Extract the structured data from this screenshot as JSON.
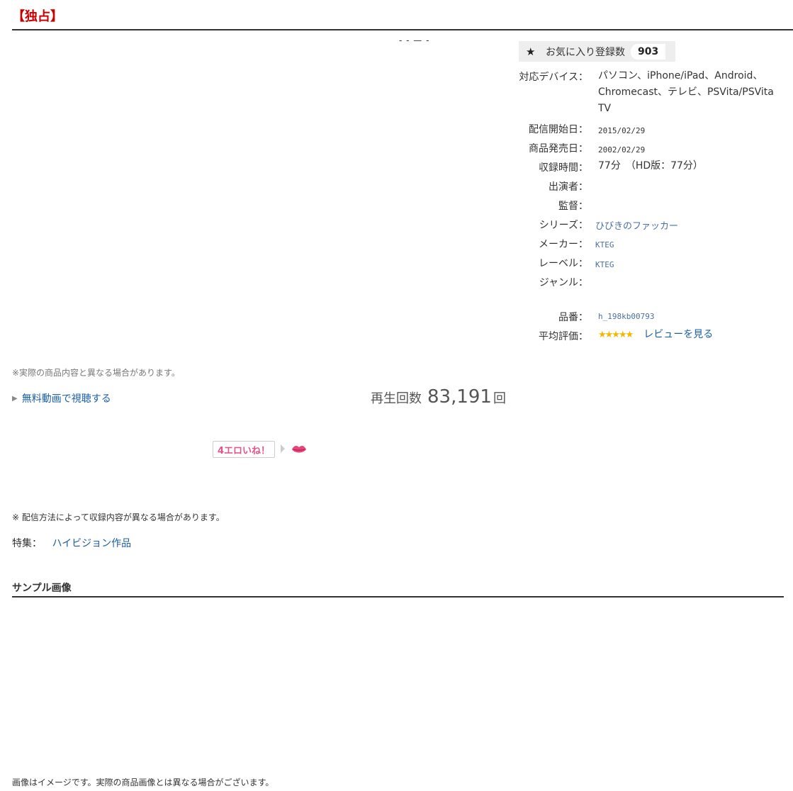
{
  "title": "【独占】",
  "player_placeholder": "- - — -",
  "favorite": {
    "label": "お気に入り登録数",
    "count": "903"
  },
  "spec": {
    "devices_label": "対応デバイス：",
    "devices_value": "パソコン、iPhone/iPad、Android、Chromecast、テレビ、PSVita/PSVita TV",
    "delivery_start_label": "配信開始日：",
    "delivery_start_value": "2015/02/29",
    "release_label": "商品発売日：",
    "release_value": "2002/02/29",
    "duration_label": "収録時間：",
    "duration_value": "77分　（HD版：77分）",
    "cast_label": "出演者：",
    "director_label": "監督：",
    "series_label": "シリーズ：",
    "series_value": "ひびきのファッカー",
    "maker_label": "メーカー：",
    "maker_value": "KTEG",
    "label_label": "レーベル：",
    "label_value": "KTEG",
    "genre_label": "ジャンル：",
    "product_code_label": "品番：",
    "product_code_value": "h_198kb00793",
    "rating_label": "平均評価：",
    "rating_stars": "★★★★★",
    "review_link": "レビューを見る"
  },
  "notice_content": "※実際の商品内容と異なる場合があります。",
  "free_video_link": "無料動画で視聴する",
  "play_count": {
    "prefix": "再生回数",
    "value": "83,191",
    "suffix": "回"
  },
  "like_button": "4エロいね！",
  "notice_method": "※ 配信方法によって収録内容が異なる場合があります。",
  "special": {
    "label": "特集：",
    "link": "ハイビジョン作品"
  },
  "sample_section_title": "サンプル画像",
  "notice_image": "画像はイメージです。実際の商品画像とは異なる場合がございます。",
  "colors": {
    "title": "#cc0000",
    "link": "#1a5fa6",
    "stars": "#f2b800",
    "like": "#e0548a"
  }
}
